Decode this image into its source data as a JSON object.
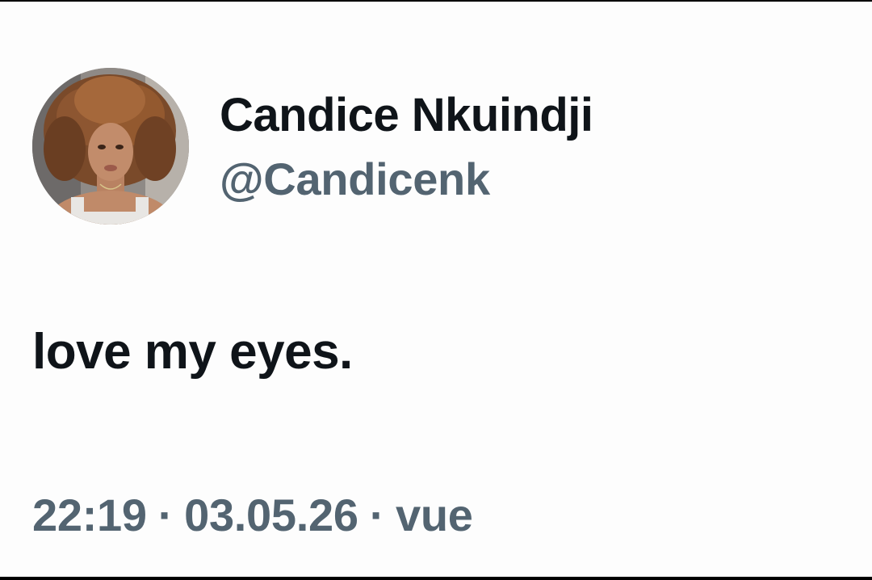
{
  "tweet": {
    "author": {
      "display_name": "Candice Nkuindji",
      "handle": "@Candicenk",
      "avatar_icon": "profile-photo"
    },
    "text": "love my eyes.",
    "meta": {
      "time": "22:19",
      "separator": "·",
      "date": "03.05.26",
      "views_label": "vue"
    }
  },
  "colors": {
    "background": "#fdfdfd",
    "primary_text": "#0f1419",
    "secondary_text": "#536471",
    "frame": "#000000"
  }
}
